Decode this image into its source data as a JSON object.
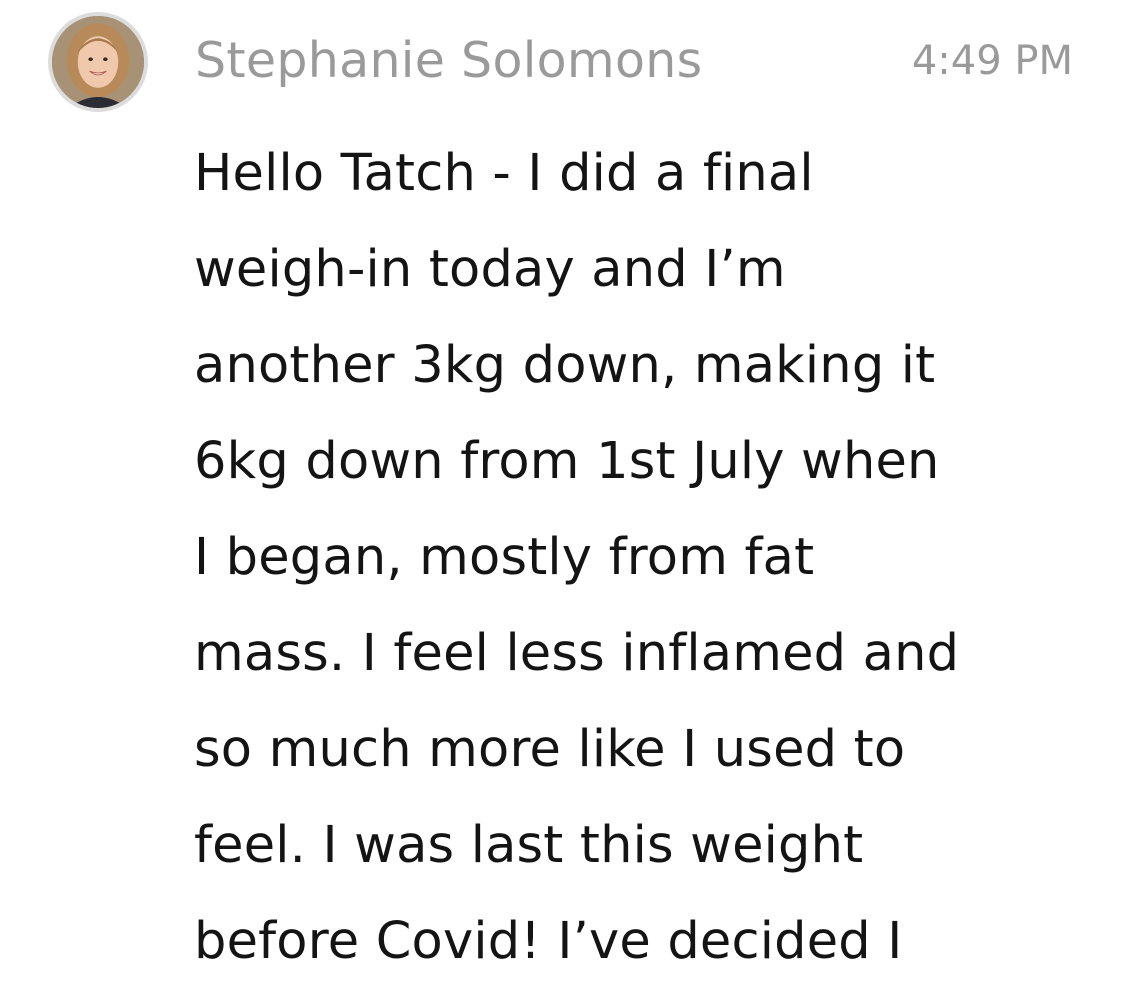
{
  "message": {
    "avatar_icon": "user-photo-avatar",
    "sender_name": "Stephanie Solomons",
    "timestamp": "4:49 PM",
    "lines": [
      "Hello Tatch - I did a final",
      "weigh-in today and I’m",
      "another 3kg down, making it",
      "6kg down from 1st July when",
      "I began, mostly from fat",
      "mass. I feel less inflamed and",
      "so much more like I used to",
      "feel. I was last this weight",
      "before Covid! I’ve decided I"
    ]
  },
  "colors": {
    "meta_text": "#9a9a9a",
    "body_text": "#141414",
    "background": "#ffffff"
  }
}
